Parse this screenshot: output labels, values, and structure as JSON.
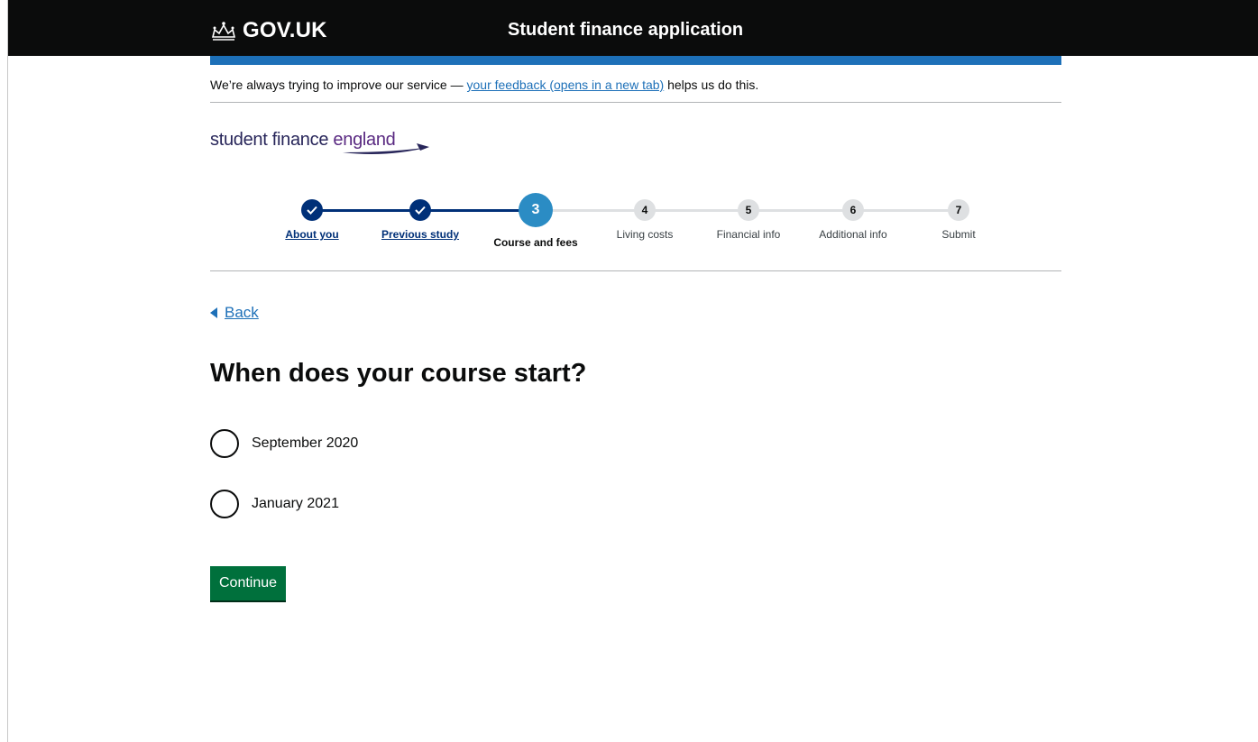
{
  "header": {
    "logo_text": "GOV.UK",
    "service_name": "Student finance application"
  },
  "feedback": {
    "prefix": "We’re always trying to improve our service — ",
    "link": "your feedback (opens in a new tab)",
    "suffix": " helps us do this."
  },
  "brand": {
    "part1": "student finance ",
    "part2": "england"
  },
  "steps": [
    {
      "number": "✓",
      "label": "About you",
      "state": "done"
    },
    {
      "number": "✓",
      "label": "Previous study",
      "state": "done"
    },
    {
      "number": "3",
      "label": "Course and fees",
      "state": "current"
    },
    {
      "number": "4",
      "label": "Living costs",
      "state": "future"
    },
    {
      "number": "5",
      "label": "Financial info",
      "state": "future"
    },
    {
      "number": "6",
      "label": "Additional info",
      "state": "future"
    },
    {
      "number": "7",
      "label": "Submit",
      "state": "future"
    }
  ],
  "back_label": "Back",
  "question": "When does your course start?",
  "options": [
    {
      "label": "September 2020",
      "selected": false
    },
    {
      "label": "January 2021",
      "selected": false
    }
  ],
  "continue_label": "Continue",
  "colors": {
    "header_bg": "#0b0c0c",
    "accent_blue": "#1d70b8",
    "done_step": "#003078",
    "current_step": "#2b8cc4",
    "button_green": "#00703c"
  }
}
